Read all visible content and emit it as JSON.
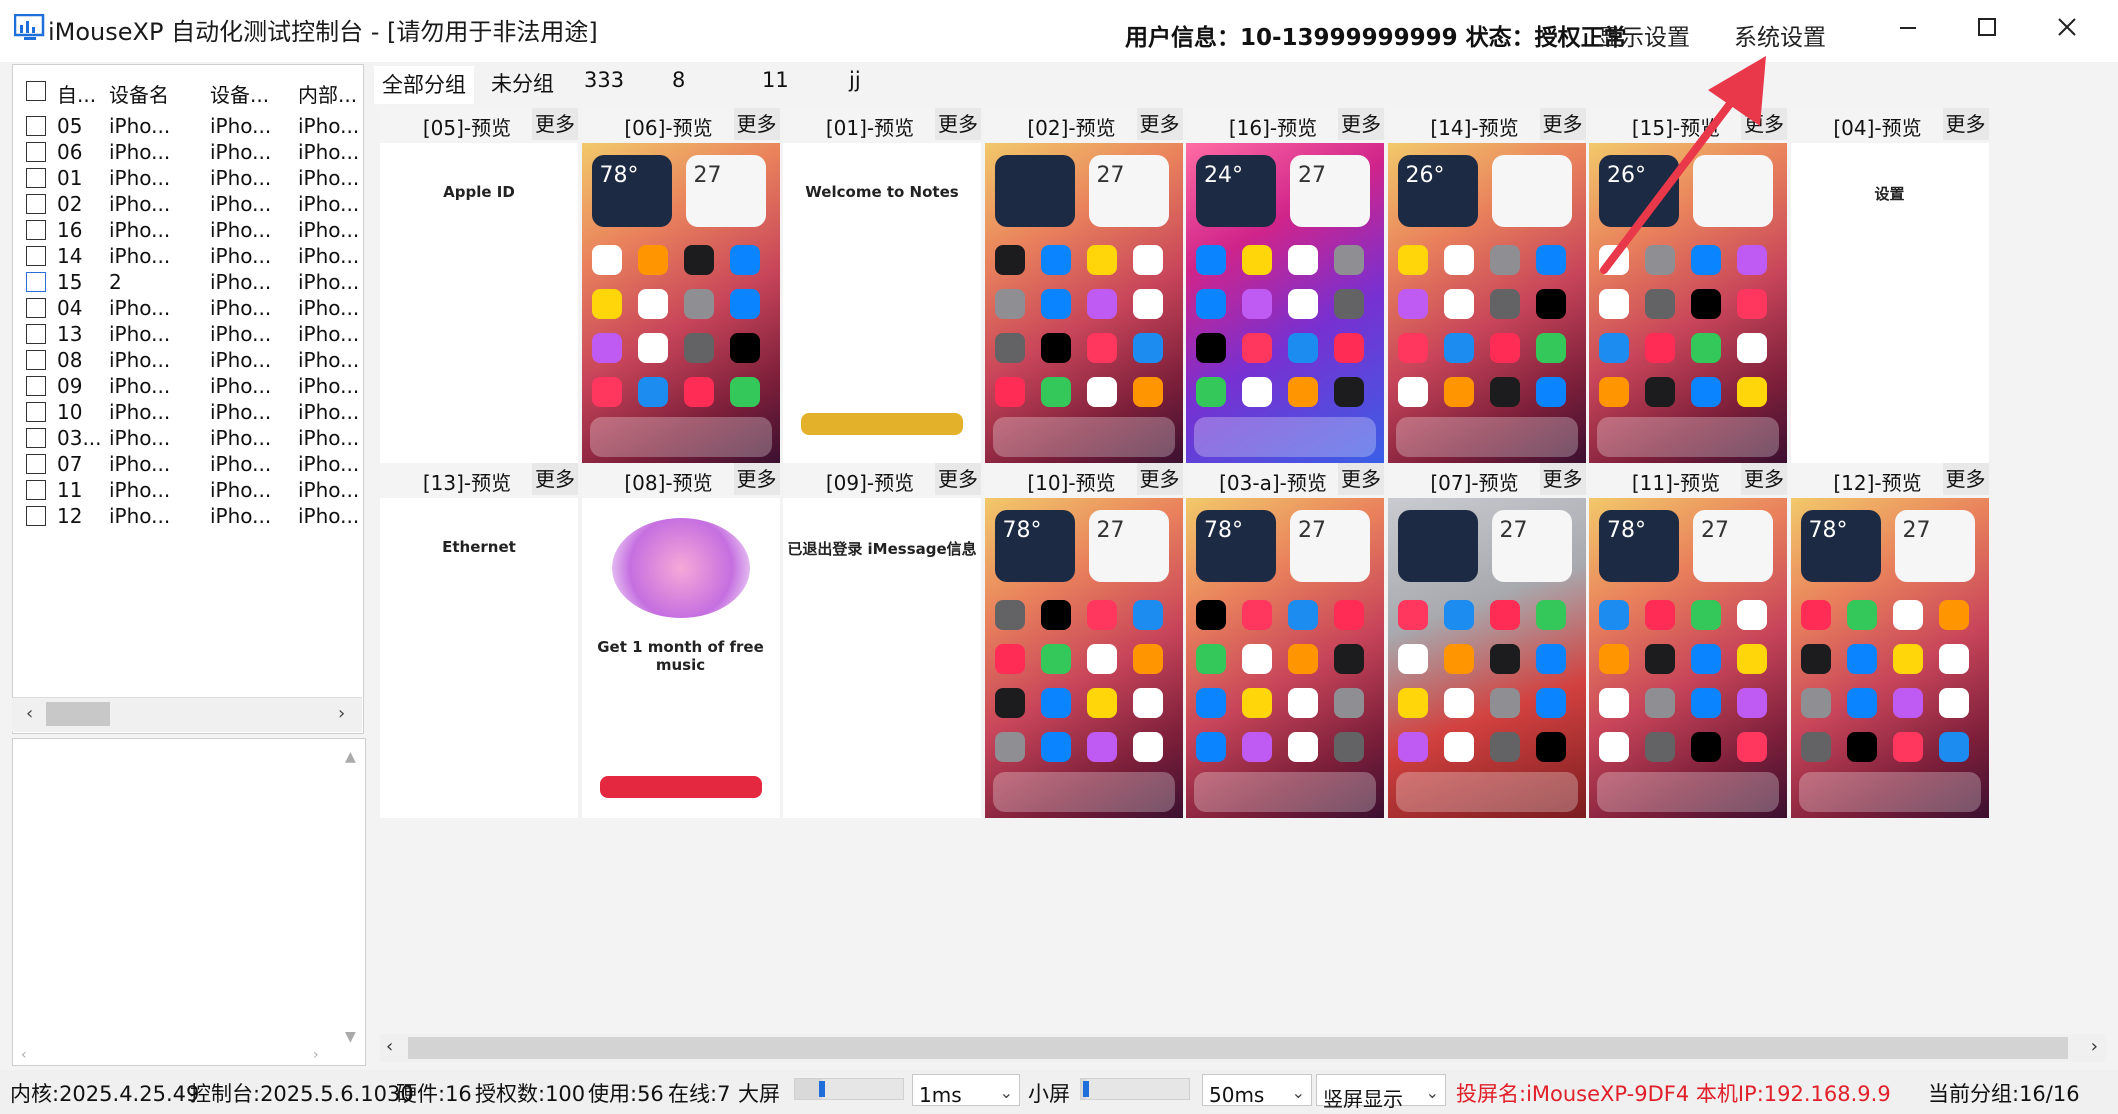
{
  "window": {
    "title": "iMouseXP 自动化测试控制台 - [请勿用于非法用途]",
    "user_info": "用户信息：10-13999999999 状态：授权正常",
    "display_settings": "显示设置",
    "system_settings": "系统设置"
  },
  "device_table": {
    "headers": [
      "自...",
      "设备名",
      "设备...",
      "内部..."
    ],
    "rows": [
      {
        "id": "05",
        "name": "iPho...",
        "model": "iPho...",
        "internal": "iPho..."
      },
      {
        "id": "06",
        "name": "iPho...",
        "model": "iPho...",
        "internal": "iPho..."
      },
      {
        "id": "01",
        "name": "iPho...",
        "model": "iPho...",
        "internal": "iPho..."
      },
      {
        "id": "02",
        "name": "iPho...",
        "model": "iPho...",
        "internal": "iPho..."
      },
      {
        "id": "16",
        "name": "iPho...",
        "model": "iPho...",
        "internal": "iPho..."
      },
      {
        "id": "14",
        "name": "iPho...",
        "model": "iPho...",
        "internal": "iPho..."
      },
      {
        "id": "15",
        "name": "2",
        "model": "iPho...",
        "internal": "iPho..."
      },
      {
        "id": "04",
        "name": "iPho...",
        "model": "iPho...",
        "internal": "iPho..."
      },
      {
        "id": "13",
        "name": "iPho...",
        "model": "iPho...",
        "internal": "iPho..."
      },
      {
        "id": "08",
        "name": "iPho...",
        "model": "iPho...",
        "internal": "iPho..."
      },
      {
        "id": "09",
        "name": "iPho...",
        "model": "iPho...",
        "internal": "iPho..."
      },
      {
        "id": "10",
        "name": "iPho...",
        "model": "iPho...",
        "internal": "iPho..."
      },
      {
        "id": "03...",
        "name": "iPho...",
        "model": "iPho...",
        "internal": "iPho..."
      },
      {
        "id": "07",
        "name": "iPho...",
        "model": "iPho...",
        "internal": "iPho..."
      },
      {
        "id": "11",
        "name": "iPho...",
        "model": "iPho...",
        "internal": "iPho..."
      },
      {
        "id": "12",
        "name": "iPho...",
        "model": "iPho...",
        "internal": "iPho..."
      }
    ]
  },
  "groups": [
    "全部分组",
    "未分组",
    "333",
    "8",
    "11",
    "jj"
  ],
  "tiles": [
    {
      "title": "[05]-预览",
      "more": "更多",
      "kind": "app",
      "app_text": "Apple ID"
    },
    {
      "title": "[06]-预览",
      "more": "更多",
      "kind": "home",
      "widget": "78°",
      "widget2": "27"
    },
    {
      "title": "[01]-预览",
      "more": "更多",
      "kind": "app",
      "app_text": "Welcome to Notes"
    },
    {
      "title": "[02]-预览",
      "more": "更多",
      "kind": "home",
      "widget": "",
      "widget2": "27"
    },
    {
      "title": "[16]-预览",
      "more": "更多",
      "kind": "home-pink",
      "widget": "24°",
      "widget2": "27"
    },
    {
      "title": "[14]-预览",
      "more": "更多",
      "kind": "home",
      "widget": "26°",
      "widget2": ""
    },
    {
      "title": "[15]-预览",
      "more": "更多",
      "kind": "home",
      "widget": "26°",
      "widget2": ""
    },
    {
      "title": "[04]-预览",
      "more": "更多",
      "kind": "app",
      "app_text": "设置"
    },
    {
      "title": "[13]-预览",
      "more": "更多",
      "kind": "app",
      "app_text": "Ethernet"
    },
    {
      "title": "[08]-预览",
      "more": "更多",
      "kind": "app",
      "app_text": "Get 1 month of free music"
    },
    {
      "title": "[09]-预览",
      "more": "更多",
      "kind": "app",
      "app_text": "已退出登录 iMessage信息"
    },
    {
      "title": "[10]-预览",
      "more": "更多",
      "kind": "home",
      "widget": "78°",
      "widget2": "27"
    },
    {
      "title": "[03-a]-预览",
      "more": "更多",
      "kind": "home",
      "widget": "78°",
      "widget2": "27"
    },
    {
      "title": "[07]-预览",
      "more": "更多",
      "kind": "home-gray",
      "widget": "",
      "widget2": "27"
    },
    {
      "title": "[11]-预览",
      "more": "更多",
      "kind": "home",
      "widget": "78°",
      "widget2": "27"
    },
    {
      "title": "[12]-预览",
      "more": "更多",
      "kind": "home",
      "widget": "78°",
      "widget2": "27"
    }
  ],
  "status": {
    "kernel": "内核:2025.4.25.49",
    "console": "控制台:2025.5.6.1030",
    "hardware": "硬件:16",
    "license": "授权数:100",
    "used": "使用:56",
    "online": "在线:7",
    "big_screen": "大屏",
    "big_interval": "1ms",
    "small_screen": "小屏",
    "small_interval": "50ms",
    "orientation": "竖屏显示",
    "projection": "投屏名:iMouseXP-9DF4 本机IP:192.168.9.9",
    "current_group": "当前分组:16/16",
    "big_slider_level": 0.25,
    "small_slider_level": 0.05
  },
  "colors": {
    "projection_text": "#e0202a",
    "accent": "#1e6fd9",
    "arrow": "#e8384a"
  }
}
